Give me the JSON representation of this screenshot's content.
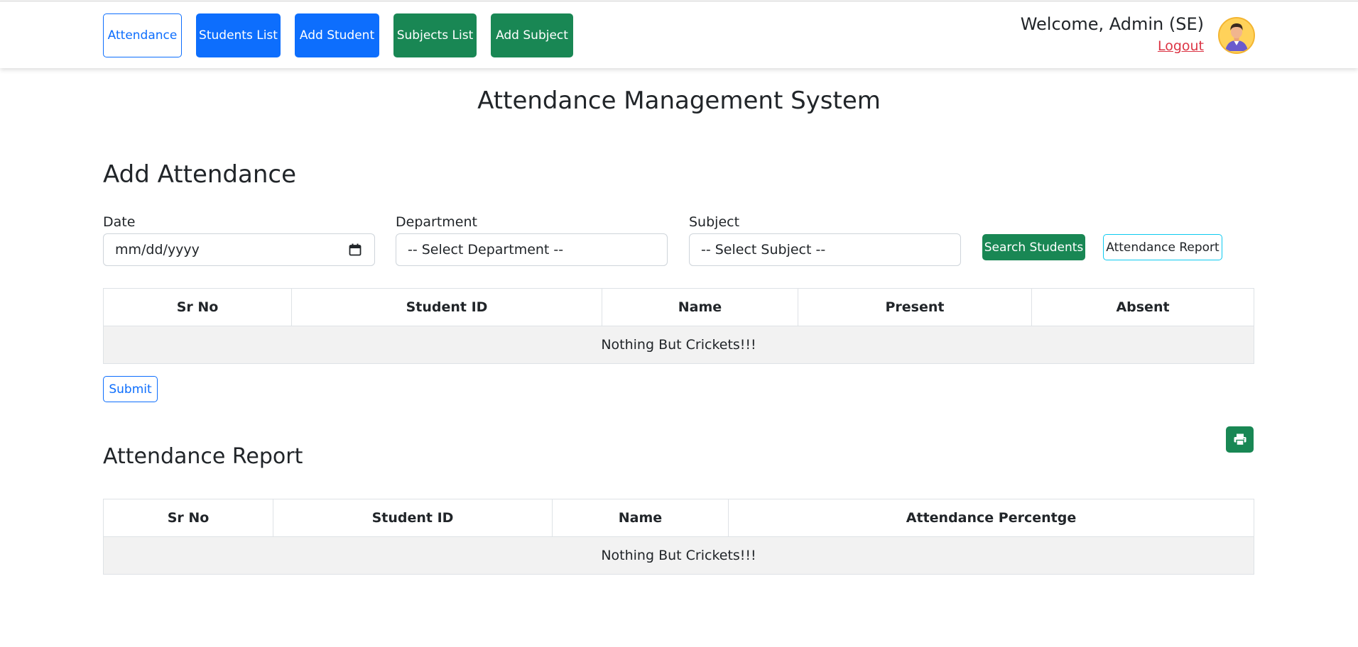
{
  "nav": {
    "attendance": "Attendance",
    "students_list": "Students List",
    "add_student": "Add Student",
    "subjects_list": "Subjects List",
    "add_subject": "Add Subject"
  },
  "user": {
    "welcome": "Welcome, Admin (SE)",
    "logout": "Logout",
    "avatar_icon": "user-avatar"
  },
  "page_title": "Attendance Management System",
  "add_attendance": {
    "title": "Add Attendance",
    "date_label": "Date",
    "date_value": "mm/dd/yyyy",
    "department_label": "Department",
    "department_selected": "-- Select Department --",
    "subject_label": "Subject",
    "subject_selected": "-- Select Subject --",
    "search_button": "Search Students",
    "report_button": "Attendance Report",
    "table": {
      "headers": [
        "Sr No",
        "Student ID",
        "Name",
        "Present",
        "Absent"
      ],
      "empty_message": "Nothing But Crickets!!!"
    },
    "submit_button": "Submit"
  },
  "attendance_report": {
    "title": "Attendance Report",
    "print_icon": "print-icon",
    "table": {
      "headers": [
        "Sr No",
        "Student ID",
        "Name",
        "Attendance Percentge"
      ],
      "empty_message": "Nothing But Crickets!!!"
    }
  },
  "colors": {
    "primary": "#0d6efd",
    "success": "#198754",
    "danger": "#dc3545",
    "info": "#0dcaf0"
  }
}
